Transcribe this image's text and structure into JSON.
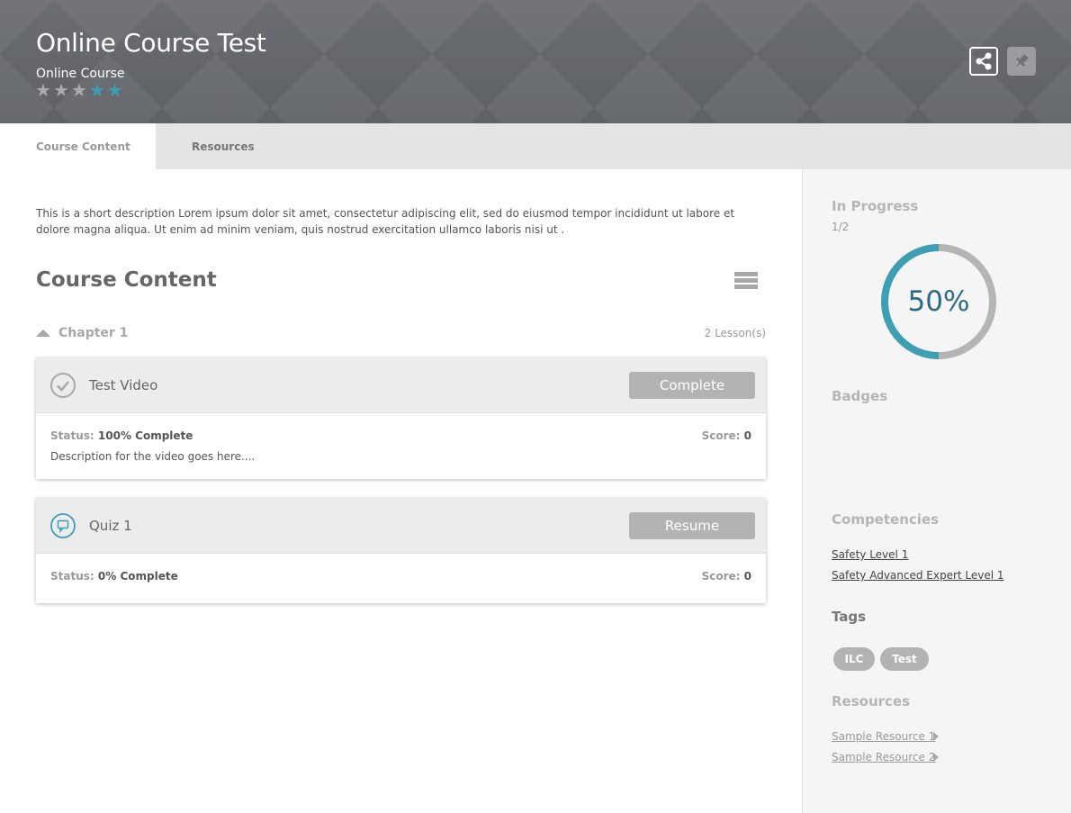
{
  "header": {
    "title": "Online Course Test",
    "subtitle": "Online Course",
    "rating_stars": [
      "★",
      "★",
      "★",
      "★",
      "★"
    ],
    "rating_value": 2,
    "rating_max": 5
  },
  "tabs": [
    {
      "label": "Course Content",
      "active": true
    },
    {
      "label": "Resources",
      "active": false
    }
  ],
  "main": {
    "description": "This is a short description Lorem ipsum dolor sit amet, consectetur adipiscing elit, sed do eiusmod tempor incididunt ut labore et dolore magna aliqua. Ut enim ad minim veniam, quis nostrud exercitation ullamco laboris nisi ut .",
    "section_title": "Course Content",
    "chapter": {
      "title": "Chapter 1",
      "lesson_count": "2 Lesson(s)"
    },
    "lessons": [
      {
        "name": "Test Video",
        "icon": "check-circle-icon",
        "button_label": "Complete",
        "status_label": "Status:",
        "status_value": "100% Complete",
        "score_label": "Score:",
        "score_value": "0",
        "description": "Description for the video goes here...."
      },
      {
        "name": "Quiz 1",
        "icon": "quiz-icon",
        "button_label": "Resume",
        "status_label": "Status:",
        "status_value": "0% Complete",
        "score_label": "Score:",
        "score_value": "0",
        "description": ""
      }
    ]
  },
  "sidebar": {
    "progress_heading": "In Progress",
    "progress_count": "1/2",
    "progress_percent_label": "50%",
    "progress_fraction": 0.5,
    "badges_heading": "Badges",
    "competencies_heading": "Competencies",
    "competencies": [
      "Safety Level 1",
      "Safety Advanced Expert Level 1"
    ],
    "tags_heading": "Tags",
    "tags": [
      "ILC",
      "Test"
    ],
    "resources_heading": "Resources",
    "resources": [
      "Sample Resource 1",
      "Sample Resource 2"
    ]
  },
  "colors": {
    "accent": "#3f9fb2",
    "percent_text": "#2f6a82",
    "button_gray": "#b3b3b3",
    "header_bg": "#6b6e72"
  },
  "icons": {
    "share": "share-icon",
    "pin": "pin-icon",
    "list_view": "list-view-icon",
    "chapter_toggle": "caret-up-icon",
    "resource_caret": "caret-right-icon"
  }
}
